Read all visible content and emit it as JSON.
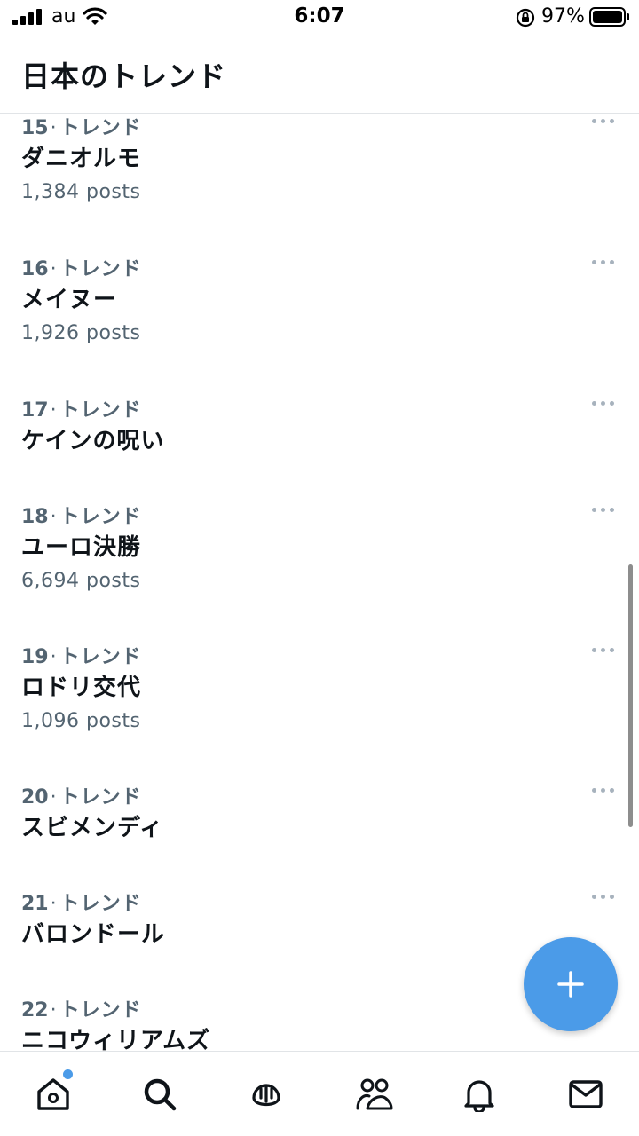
{
  "status_bar": {
    "carrier": "au",
    "time": "6:07",
    "battery_percent": "97%",
    "icons": [
      "signal-icon",
      "wifi-icon",
      "orientation-lock-icon",
      "battery-icon"
    ]
  },
  "header": {
    "title": "日本のトレンド"
  },
  "trends": [
    {
      "rank": "15",
      "separator": "·",
      "category": "トレンド",
      "name": "ダニオルモ",
      "posts": "1,384 posts"
    },
    {
      "rank": "16",
      "separator": "·",
      "category": "トレンド",
      "name": "メイヌー",
      "posts": "1,926 posts"
    },
    {
      "rank": "17",
      "separator": "·",
      "category": "トレンド",
      "name": "ケインの呪い",
      "posts": ""
    },
    {
      "rank": "18",
      "separator": "·",
      "category": "トレンド",
      "name": "ユーロ決勝",
      "posts": "6,694 posts"
    },
    {
      "rank": "19",
      "separator": "·",
      "category": "トレンド",
      "name": "ロドリ交代",
      "posts": "1,096 posts"
    },
    {
      "rank": "20",
      "separator": "·",
      "category": "トレンド",
      "name": "スビメンディ",
      "posts": ""
    },
    {
      "rank": "21",
      "separator": "·",
      "category": "トレンド",
      "name": "バロンドール",
      "posts": ""
    },
    {
      "rank": "22",
      "separator": "·",
      "category": "トレンド",
      "name": "ニコウィリアムズ",
      "posts": ""
    }
  ],
  "fab": {
    "icon": "plus-icon"
  },
  "bottom_nav": {
    "items": [
      "home-icon",
      "search-icon",
      "spaces-icon",
      "communities-icon",
      "notifications-icon",
      "messages-icon"
    ],
    "home_has_unread_dot": true
  },
  "colors": {
    "accent": "#4b9be8",
    "text_primary": "#0f1419",
    "text_secondary": "#536471",
    "divider": "#e1e4e7"
  }
}
